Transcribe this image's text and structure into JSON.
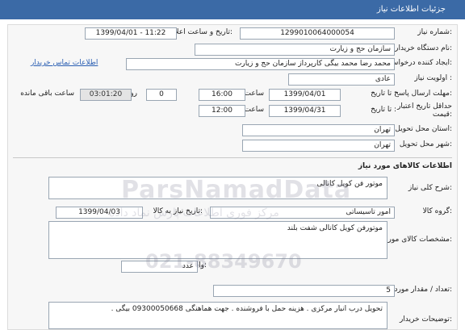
{
  "header": {
    "title": "جزئیات اطلاعات نیاز"
  },
  "fields": {
    "need_number_label": "شماره نیاز:",
    "need_number": "1299010064000054",
    "announce_datetime_label": "تاریخ و ساعت اعلان عمومی:",
    "announce_datetime": "1399/04/01 - 11:22",
    "buyer_org_label": "نام دستگاه خریدار:",
    "buyer_org": "سازمان حج و زیارت",
    "requester_label": "ایجاد کننده درخواست:",
    "requester": "محمد رضا محمد بیگی کارپرداز سازمان حج و زیارت",
    "buyer_contact_link": "اطلاعات تماس خریدار",
    "priority_label": "اولویت نیاز :",
    "priority": "عادی",
    "send_deadline_label": "مهلت ارسال پاسخ:",
    "until_date_label": "تا تاریخ :",
    "send_deadline_date": "1399/04/01",
    "time_label": "ساعت",
    "send_deadline_time": "16:00",
    "days_value": "0",
    "days_label": "روز و",
    "remaining_time": "03:01:20",
    "remaining_label": "ساعت باقی مانده",
    "price_validity_label": "حداقل تاریخ اعتبار قیمت:",
    "price_until_label": "تا تاریخ :",
    "price_validity_date": "1399/04/31",
    "price_time_label": "ساعت",
    "price_validity_time": "12:00",
    "delivery_province_label": "استان محل تحویل:",
    "delivery_province": "تهران",
    "delivery_city_label": "شهر محل تحویل:",
    "delivery_city": "تهران"
  },
  "goods": {
    "section_title": "اطلاعات کالاهای مورد نیاز",
    "general_desc_label": "شرح کلی نیاز:",
    "general_desc": "موتور فن کویل کانالی",
    "group_label": "گروه کالا:",
    "group": "امور تاسیساتی",
    "need_date_label": "تاریخ نیاز به کالا:",
    "need_date": "1399/04/03",
    "specs_label": "مشخصات کالای مورد نیاز:",
    "specs": "موتورفن کویل  کانالی  شفت بلند",
    "unit_label": "واحد شمارش:",
    "unit": "عدد",
    "quantity_label": "تعداد / مقدار مورد نیاز:",
    "quantity": "5",
    "buyer_notes_label": "توضیحات خریدار:",
    "buyer_notes": "تحویل درب انبار مرکزی . هزینه حمل با فروشنده . جهت هماهنگی 09300050668 بیگی ."
  },
  "watermark": {
    "brand": "ParsNamadData",
    "line1": "مرکز فوری اطلاعات پارس نماد داده",
    "line2": "021-88349670"
  }
}
